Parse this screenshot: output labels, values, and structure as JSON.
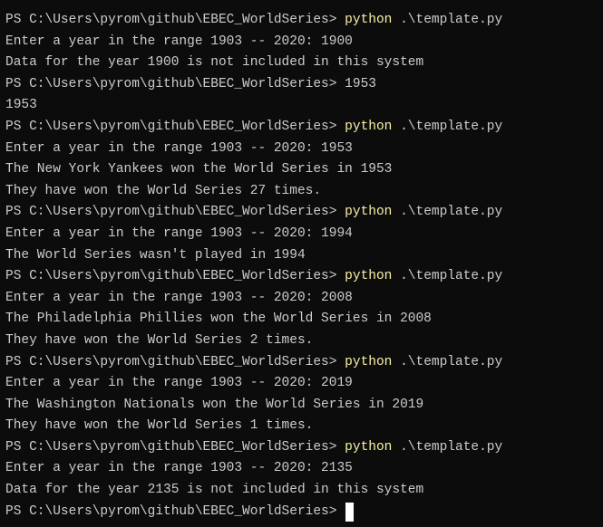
{
  "terminal": {
    "prompt": "PS C:\\Users\\pyrom\\github\\EBEC_WorldSeries> ",
    "command": "python",
    "command_arg": " .\\template.py",
    "lines": {
      "l2": "Enter a year in the range 1903 -- 2020: 1900",
      "l3": "Data for the year 1900 is not included in this system",
      "l4_input": "1953",
      "l5": "1953",
      "l7": "Enter a year in the range 1903 -- 2020: 1953",
      "l8": "The New York Yankees won the World Series in 1953",
      "l9": "They have won the World Series 27 times.",
      "l11": "Enter a year in the range 1903 -- 2020: 1994",
      "l12": "The World Series wasn't played in 1994",
      "l14": "Enter a year in the range 1903 -- 2020: 2008",
      "l15": "The Philadelphia Phillies won the World Series in 2008",
      "l16": "They have won the World Series 2 times.",
      "l18": "Enter a year in the range 1903 -- 2020: 2019",
      "l19": "The Washington Nationals won the World Series in 2019",
      "l20": "They have won the World Series 1 times.",
      "l22": "Enter a year in the range 1903 -- 2020: 2135",
      "l23": "Data for the year 2135 is not included in this system"
    }
  },
  "colors": {
    "background": "#0c0c0c",
    "text": "#cccccc",
    "command": "#f9f1a5",
    "cursor": "#ffffff"
  }
}
